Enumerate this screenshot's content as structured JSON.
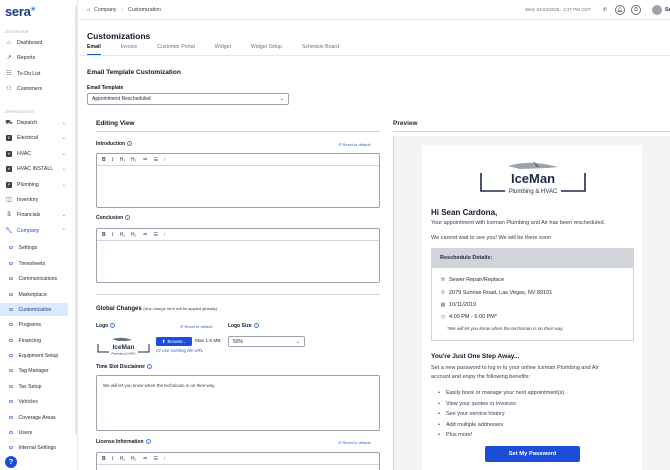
{
  "app": {
    "logo": "sera"
  },
  "sidebar": {
    "sections": {
      "overview": "OVERVIEW",
      "operations": "OPERATIONS"
    },
    "overview_items": [
      {
        "label": "Dashboard",
        "icon": "home-icon"
      },
      {
        "label": "Reports",
        "icon": "trend-icon"
      },
      {
        "label": "To-Do List",
        "icon": "checklist-icon"
      },
      {
        "label": "Customers",
        "icon": "users-icon"
      }
    ],
    "operation_items": [
      {
        "label": "Dispatch",
        "icon": "truck-icon"
      },
      {
        "label": "Electrical",
        "badge": "E"
      },
      {
        "label": "HVAC",
        "badge": "H"
      },
      {
        "label": "HVAC INSTALL",
        "badge": "H"
      },
      {
        "label": "Plumbing",
        "badge": "P"
      },
      {
        "label": "Inventory",
        "icon": "box-icon"
      },
      {
        "label": "Financials",
        "icon": "dollar-icon"
      },
      {
        "label": "Company",
        "icon": "wrench-icon"
      }
    ],
    "company_subitems": [
      "Settings",
      "Timesheets",
      "Communications",
      "Marketplace",
      "Customization",
      "Programs",
      "Financing",
      "Equipment Setup",
      "Tag Manager",
      "Tax Setup",
      "Vehicles",
      "Coverage Areas",
      "Users",
      "Internal Settings"
    ],
    "active_item": "Customization",
    "help_label": "?"
  },
  "topbar": {
    "breadcrumb": [
      "Company",
      "Customization"
    ],
    "datetime": "Wed, 04/23/2025 - 2:37 PM CDT",
    "user_initial": "Se"
  },
  "page": {
    "title": "Customizations",
    "tabs": [
      "Email",
      "Invoice",
      "Customer Portal",
      "Widget",
      "Widget Setup",
      "Schedule Board"
    ],
    "active_tab": "Email"
  },
  "template_section": {
    "heading": "Email Template Customization",
    "template_label": "Email Template",
    "template_value": "Appointment Rescheduled"
  },
  "editing": {
    "heading": "Editing View",
    "reset_label": "Reset to default",
    "introduction_label": "Introduction",
    "conclusion_label": "Conclusion",
    "toolbar": {
      "bold": "B",
      "italic": "I",
      "h1": "H₁",
      "h2": "H₂",
      "ol": "≔",
      "ul": "☰",
      "hr": "⁝"
    },
    "global_heading": "Global Changes",
    "global_note": "(Any change here will be applied globally)",
    "logo_label": "Logo",
    "browse_label": "Browse...",
    "max_size": "Max 1.5 MB",
    "existing_file": "Or use existing file URL",
    "logo_size_label": "Logo Size",
    "logo_size_value": "50%",
    "disclaimer_label": "Time Slot Disclaimer",
    "disclaimer_text": "We will let you know when the technician is on their way.",
    "license_label": "License Information"
  },
  "preview": {
    "heading": "Preview",
    "brand_name": "IceMan",
    "brand_sub": "Plumbing & HVAC",
    "greeting": "Hi Sean Cardona,",
    "line1": "Your appointment with Iceman Plumbing and Air has been rescheduled.",
    "line2": "We cannot wait to see you! We will be there soon",
    "details_heading": "Reschedule Details:",
    "service": "Sewer Repair/Replace",
    "address": "2079 Sunrise Road, Las Vegas, NV 89101",
    "date": "10/11/2019",
    "time": "4:00 PM - 6:00 PM*",
    "note": "*We will let you know when the technician is on their way.",
    "away_heading": "You're Just One Step Away...",
    "away_line1": "Set a new password to log in to your online Iceman Plumbing and Air",
    "away_line2": "account and enjoy the following benefits:",
    "benefits": [
      "Easily book or manage your next appointment(s)",
      "View your quotes or invoices",
      "See your service history",
      "Add multiple addresses",
      "Plus more!"
    ],
    "cta": "Set My Password"
  }
}
